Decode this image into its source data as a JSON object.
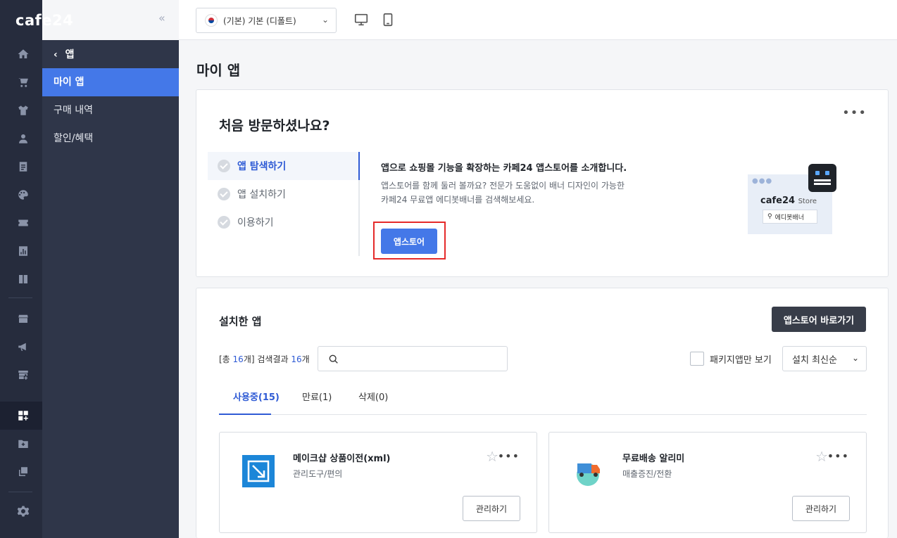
{
  "brand": {
    "logo_text": "cafe24",
    "collapse_icon": "double-chevron-left-icon"
  },
  "rail_icons": [
    "home-icon",
    "cart-icon",
    "shirt-icon",
    "person-icon",
    "document-icon",
    "palette-icon",
    "coupon-icon",
    "chart-icon",
    "book-icon",
    "store-icon",
    "megaphone-icon",
    "shop-add-icon",
    "apps-icon",
    "folder-add-icon",
    "copy-icon",
    "gear-icon"
  ],
  "submenu": {
    "back_label": "앱",
    "items": [
      {
        "label": "마이 앱",
        "active": true
      },
      {
        "label": "구매 내역",
        "active": false
      },
      {
        "label": "할인/혜택",
        "active": false
      }
    ]
  },
  "topbar": {
    "lang_select": "(기본) 기본 (디폴트)"
  },
  "page": {
    "title": "마이 앱"
  },
  "welcome": {
    "title": "처음 방문하셨나요?",
    "steps": [
      {
        "label": "앱 탐색하기",
        "active": true
      },
      {
        "label": "앱 설치하기",
        "active": false
      },
      {
        "label": "이용하기",
        "active": false
      }
    ],
    "headline": "앱으로 쇼핑몰 기능을 확장하는 카페24 앱스토어를 소개합니다.",
    "desc_line1": "앱스토어를 함께 둘러 볼까요? 전문가 도움없이 배너 디자인이 가능한",
    "desc_line2": "카페24 무료앱 에디봇배너를 검색해보세요.",
    "button": "앱스토어",
    "art": {
      "brand": "cafe24",
      "brand_sub": "Store",
      "search_text": "에디봇배너"
    }
  },
  "installed": {
    "title": "설치한 앱",
    "store_button": "앱스토어 바로가기",
    "count_prefix": "[총 ",
    "count_total": "16",
    "count_mid": "개] 검색결과 ",
    "count_result": "16",
    "count_suffix": "개",
    "package_only": "패키지앱만 보기",
    "sort": "설치 최신순",
    "tabs": [
      {
        "label": "사용중(15)",
        "active": true
      },
      {
        "label": "만료(1)",
        "active": false
      },
      {
        "label": "삭제(0)",
        "active": false
      }
    ],
    "apps": [
      {
        "name": "메이크샵 상품이전(xml)",
        "category": "관리도구/편의",
        "manage": "관리하기"
      },
      {
        "name": "무료배송 알리미",
        "category": "매출증진/전환",
        "manage": "관리하기"
      }
    ]
  }
}
